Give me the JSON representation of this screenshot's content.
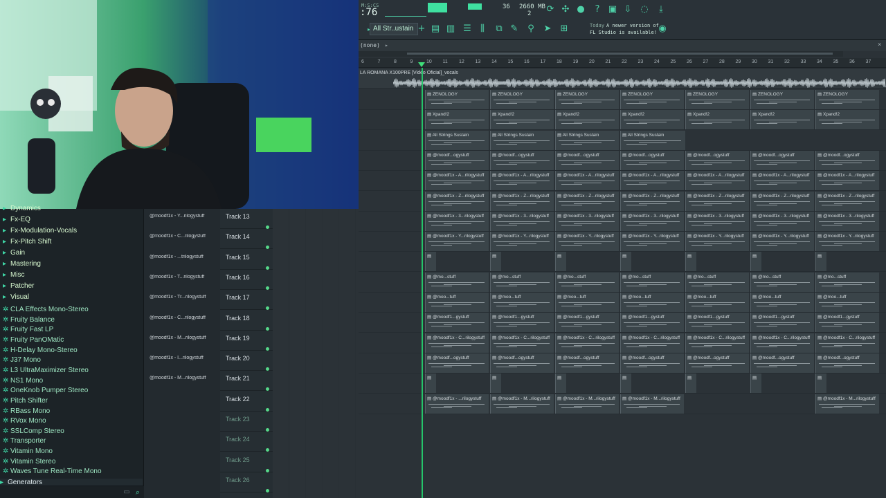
{
  "toolbar": {
    "time": ":76",
    "mscs": "M:S:CS",
    "cpu_value": "36",
    "ram_value": "2660 MB",
    "poly_value": "2",
    "pattern_selector": "All Str..ustain",
    "news_today": "Today",
    "news_text": "A newer version of",
    "news_text2": "FL Studio is available!"
  },
  "playlist": {
    "arrangement": "(none)",
    "audio_track_name": "LA ROMANA  X100PRE [Video Oficial]_vocals",
    "ruler": [
      "6",
      "7",
      "8",
      "9",
      "10",
      "11",
      "12",
      "13",
      "14",
      "15",
      "16",
      "17",
      "18",
      "19",
      "20",
      "21",
      "22",
      "23",
      "24",
      "25",
      "26",
      "27",
      "28",
      "29",
      "30",
      "31",
      "32",
      "33",
      "34",
      "35",
      "36",
      "37"
    ]
  },
  "browser": {
    "items": [
      {
        "label": "Dynamics",
        "type": "folder"
      },
      {
        "label": "Fx-EQ",
        "type": "folder"
      },
      {
        "label": "Fx-Modulation-Vocals",
        "type": "folder"
      },
      {
        "label": "Fx-Pitch Shift",
        "type": "folder"
      },
      {
        "label": "Gain",
        "type": "folder"
      },
      {
        "label": "Mastering",
        "type": "folder"
      },
      {
        "label": "Misc",
        "type": "folder"
      },
      {
        "label": "Patcher",
        "type": "folder"
      },
      {
        "label": "Visual",
        "type": "folder"
      },
      {
        "label": "CLA Effects Mono-Stereo",
        "type": "plugin"
      },
      {
        "label": "Fruity Balance",
        "type": "plugin"
      },
      {
        "label": "Fruity Fast LP",
        "type": "plugin"
      },
      {
        "label": "Fruity PanOMatic",
        "type": "plugin"
      },
      {
        "label": "H-Delay Mono-Stereo",
        "type": "plugin"
      },
      {
        "label": "J37 Mono",
        "type": "plugin"
      },
      {
        "label": "L3 UltraMaximizer Stereo",
        "type": "plugin"
      },
      {
        "label": "NS1 Mono",
        "type": "plugin"
      },
      {
        "label": "OneKnob Pumper Stereo",
        "type": "plugin"
      },
      {
        "label": "Pitch Shifter",
        "type": "plugin"
      },
      {
        "label": "RBass Mono",
        "type": "plugin"
      },
      {
        "label": "RVox Mono",
        "type": "plugin"
      },
      {
        "label": "SSLComp Stereo",
        "type": "plugin"
      },
      {
        "label": "Transporter",
        "type": "plugin"
      },
      {
        "label": "Vitamin Mono",
        "type": "plugin"
      },
      {
        "label": "Vitamin Stereo",
        "type": "plugin"
      },
      {
        "label": "Waves Tune Real-Time Mono",
        "type": "plugin"
      },
      {
        "label": "Generators",
        "type": "folder"
      }
    ]
  },
  "picker_clips": [
    "@moodf1x - Y...rilogystuff",
    "@moodf1x - C...rilogystuff",
    "@moodf1x - ...trilogystuff",
    "@moodf1x - T...rilogystuff",
    "@moodf1x - Tr...rilogystuff",
    "@moodf1x - C...rilogystuff",
    "@moodf1x - M...rilogystuff",
    "@moodf1x - I...rilogystuff",
    "@moodf1x - M...rilogystuff"
  ],
  "tracks": [
    {
      "label": "Track 13",
      "active": true
    },
    {
      "label": "Track 14",
      "active": true
    },
    {
      "label": "Track 15",
      "active": true
    },
    {
      "label": "Track 16",
      "active": true
    },
    {
      "label": "Track 17",
      "active": true
    },
    {
      "label": "Track 18",
      "active": true
    },
    {
      "label": "Track 19",
      "active": true
    },
    {
      "label": "Track 20",
      "active": true
    },
    {
      "label": "Track 21",
      "active": true
    },
    {
      "label": "Track 22",
      "active": true
    },
    {
      "label": "Track 23",
      "active": false
    },
    {
      "label": "Track 24",
      "active": false
    },
    {
      "label": "Track 25",
      "active": false
    },
    {
      "label": "Track 26",
      "active": false
    }
  ],
  "pattern_rows": [
    {
      "label": "ZENOLOGY"
    },
    {
      "label": "Xpand!2"
    },
    {
      "label": "All Strings Sustain",
      "count": 4
    },
    {
      "label": "@moodf...ogystuff"
    },
    {
      "label": "@moodf1x - A...rilogystuff"
    },
    {
      "label": "@moodf1x - Z...rilogystuff"
    },
    {
      "label": "@moodf1x - 3...rilogystuff"
    },
    {
      "label": "@moodf1x - Y...rilogystuff"
    },
    {
      "label": ""
    },
    {
      "label": "@mo...stuff"
    },
    {
      "label": "@moo...tuff"
    },
    {
      "label": "@moodf1...gystuff"
    },
    {
      "label": "@moodf1x - C...rilogystuff"
    },
    {
      "label": "@moodf...ogystuff"
    },
    {
      "label": ""
    },
    {
      "label": "@moodf1x - ...rilogystuff",
      "alt": "@moodf1x - M...rilogystuff"
    }
  ]
}
